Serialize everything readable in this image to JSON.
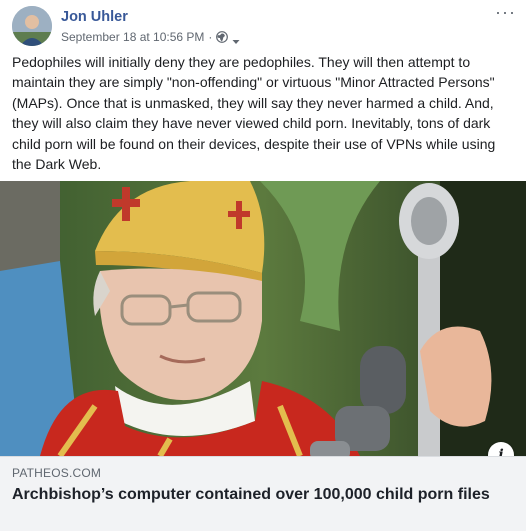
{
  "post": {
    "author": "Jon Uhler",
    "timestamp": "September 18 at 10:56 PM",
    "separator": "·",
    "privacy_icon": "globe-icon",
    "menu_icon": "more-options-icon",
    "menu_glyph": "···",
    "text": "Pedophiles will initially deny they are pedophiles. They will then attempt to maintain they are simply \"non-offending\" or virtuous \"Minor Attracted Persons\" (MAPs). Once that is unmasked, they will say they never harmed a child. And, they will also claim they have never viewed child porn. Inevitably, tons of dark child porn will be found on their devices, despite their use of VPNs while using the Dark Web."
  },
  "link_preview": {
    "domain": "PATHEOS.COM",
    "title": "Archbishop’s computer contained over 100,000 child porn files",
    "info_glyph": "i",
    "info_icon": "info-icon"
  },
  "colors": {
    "author_link": "#385898",
    "meta_text": "#606770",
    "preview_bg": "#f2f3f5"
  }
}
